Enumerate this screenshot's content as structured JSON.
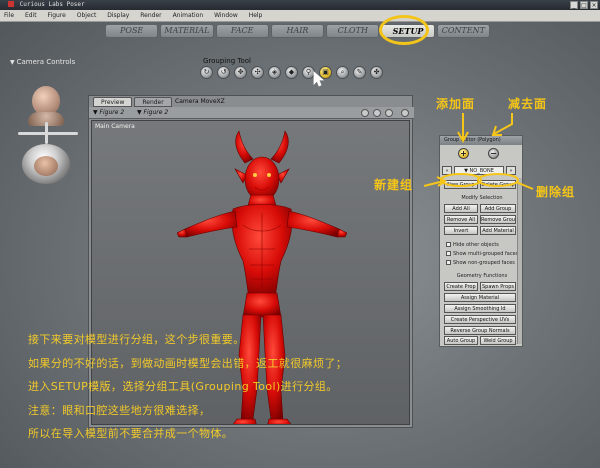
{
  "app": {
    "title": "Curious Labs Poser",
    "window_buttons": [
      "_",
      "□",
      "×"
    ]
  },
  "menu": [
    "File",
    "Edit",
    "Figure",
    "Object",
    "Display",
    "Render",
    "Animation",
    "Window",
    "Help"
  ],
  "room_tabs": [
    "POSE",
    "MATERIAL",
    "FACE",
    "HAIR",
    "CLOTH",
    "SETUP",
    "CONTENT"
  ],
  "active_tab": "SETUP",
  "camera_controls": {
    "label": "Camera Controls"
  },
  "grouping_tool": {
    "label": "Grouping Tool"
  },
  "preview": {
    "tabs": [
      "Preview",
      "Render"
    ],
    "camera": "Camera MoveXZ",
    "figure_selectors": [
      "Figure 2",
      "Figure 2"
    ],
    "viewport_label": "Main Camera"
  },
  "group_panel": {
    "title": "Group Editor (Polygon)",
    "current_group": "NO_BONE",
    "new_group": "New Group",
    "delete_group": "Delete Group",
    "modify_heading": "Modify Selection",
    "add_all": "Add All",
    "add_group": "Add Group",
    "remove_all": "Remove All",
    "remove_group": "Remove Group",
    "invert": "Invert",
    "add_material": "Add Material",
    "hide_other": "Hide other objects",
    "show_multi": "Show multi-grouped faces",
    "show_non": "Show non-grouped faces",
    "geometry_heading": "Geometry Functions",
    "create_prop": "Create Prop",
    "spawn_props": "Spawn Props",
    "assign_material": "Assign Material",
    "assign_smoothing": "Assign Smoothing Id",
    "create_perspective": "Create Perspective UVs",
    "reverse_normals": "Reverse Group Normals",
    "auto_group": "Auto Group",
    "weld_group": "Weld Group"
  },
  "annotations": {
    "add_face": "添加面",
    "remove_face": "减去面",
    "new_group": "新建组",
    "delete_group": "删除组"
  },
  "caption_lines": [
    "接下来要对模型进行分组，这个步很重要。",
    "如果分的不好的话，到做动画时模型会出错，返工就很麻烦了；",
    "进入SETUP模版，选择分组工具(Grouping Tool)进行分组。",
    "注意：眼和口腔这些地方很难选择，",
    "所以在导入模型前不要合并成一个物体。"
  ],
  "colors": {
    "annotation": "#f5c518",
    "model": "#e01010",
    "tool_selected": "#e2b826"
  },
  "icons": {
    "tool_selected": "grouping-tool-icon",
    "cursor": "arrow-cursor-icon"
  }
}
